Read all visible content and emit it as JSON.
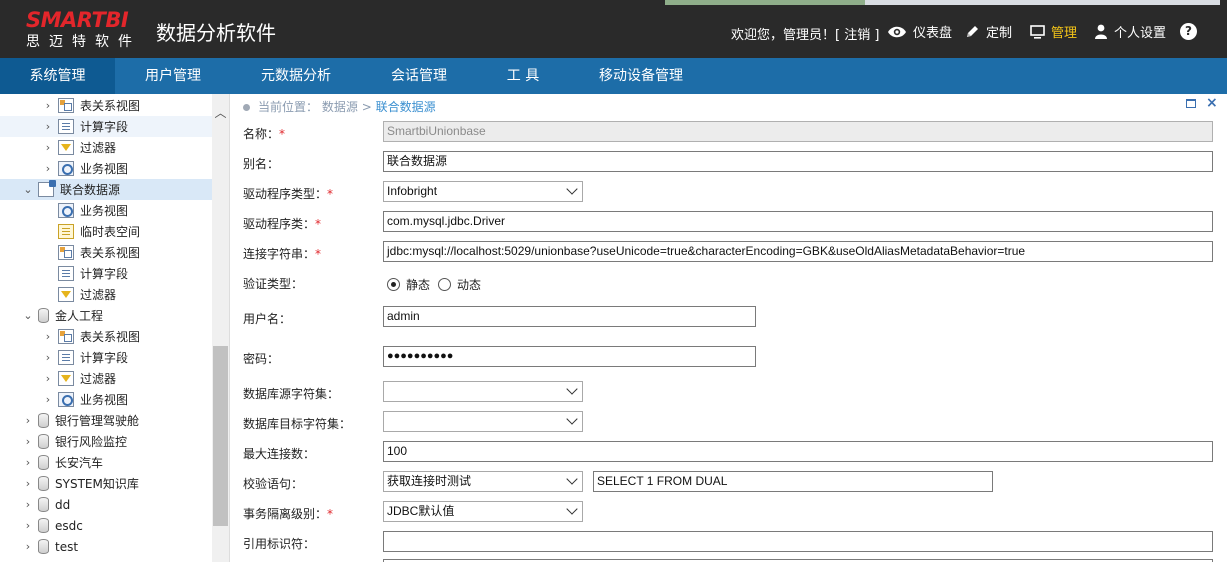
{
  "header": {
    "logo_top": "SMARTBI",
    "logo_bottom": "思迈特软件",
    "app_title": "数据分析软件",
    "welcome": "欢迎您，管理员！[ 注销 ]",
    "nav": [
      {
        "label": "仪表盘",
        "icon": "eye-icon"
      },
      {
        "label": "定制",
        "icon": "pencil-icon"
      },
      {
        "label": "管理",
        "icon": "monitor-icon",
        "active": true
      },
      {
        "label": "个人设置",
        "icon": "user-icon"
      }
    ],
    "help": "?",
    "accent_color": "#f5c518",
    "header_bg": "#2a2a2a"
  },
  "menubar": {
    "items": [
      "系统管理",
      "用户管理",
      "元数据分析",
      "会话管理",
      "工 具",
      "移动设备管理"
    ],
    "active_index": 0,
    "bg_color": "#1d6da8"
  },
  "tree": [
    {
      "label": "表关系视图",
      "icon": "table-relation-icon",
      "expander": "collapsed"
    },
    {
      "label": "计算字段",
      "icon": "calc-field-icon",
      "expander": "collapsed"
    },
    {
      "label": "过滤器",
      "icon": "filter-icon",
      "expander": "collapsed"
    },
    {
      "label": "业务视图",
      "icon": "business-view-icon",
      "expander": "collapsed"
    },
    {
      "label": "联合数据源",
      "icon": "union-datasource-icon",
      "expander": "expanded",
      "selected": true
    },
    {
      "label": "业务视图",
      "icon": "business-view-icon",
      "expander": "none"
    },
    {
      "label": "临时表空间",
      "icon": "temp-table-icon",
      "expander": "none"
    },
    {
      "label": "表关系视图",
      "icon": "table-relation-icon",
      "expander": "none"
    },
    {
      "label": "计算字段",
      "icon": "calc-field-icon",
      "expander": "none"
    },
    {
      "label": "过滤器",
      "icon": "filter-icon",
      "expander": "none"
    },
    {
      "label": "金人工程",
      "icon": "database-icon",
      "expander": "expanded"
    },
    {
      "label": "表关系视图",
      "icon": "table-relation-icon",
      "expander": "collapsed"
    },
    {
      "label": "计算字段",
      "icon": "calc-field-icon",
      "expander": "collapsed"
    },
    {
      "label": "过滤器",
      "icon": "filter-icon",
      "expander": "collapsed"
    },
    {
      "label": "业务视图",
      "icon": "business-view-icon",
      "expander": "collapsed"
    },
    {
      "label": "银行管理驾驶舱",
      "icon": "database-icon",
      "expander": "collapsed"
    },
    {
      "label": "银行风险监控",
      "icon": "database-icon",
      "expander": "collapsed"
    },
    {
      "label": "长安汽车",
      "icon": "database-icon",
      "expander": "collapsed"
    },
    {
      "label": "SYSTEM知识库",
      "icon": "database-icon",
      "expander": "collapsed"
    },
    {
      "label": "dd",
      "icon": "database-icon",
      "expander": "collapsed"
    },
    {
      "label": "esdc",
      "icon": "database-icon",
      "expander": "collapsed"
    },
    {
      "label": "test",
      "icon": "database-icon",
      "expander": "collapsed"
    }
  ],
  "breadcrumb": {
    "prefix": "当前位置：",
    "parent": "数据源",
    "sep": ">",
    "current": "联合数据源"
  },
  "form": {
    "name_label": "名称：",
    "name_value": "SmartbiUnionbase",
    "alias_label": "别名：",
    "alias_value": "联合数据源",
    "driver_type_label": "驱动程序类型：",
    "driver_type_value": "Infobright",
    "driver_class_label": "驱动程序类：",
    "driver_class_value": "com.mysql.jdbc.Driver",
    "conn_label": "连接字符串：",
    "conn_value": "jdbc:mysql://localhost:5029/unionbase?useUnicode=true&characterEncoding=GBK&useOldAliasMetadataBehavior=true",
    "auth_label": "验证类型：",
    "auth_static": "静态",
    "auth_dynamic": "动态",
    "auth_selected": "静态",
    "user_label": "用户名：",
    "user_value": "admin",
    "pwd_label": "密码：",
    "pwd_value": "●●●●●●●●●●",
    "src_charset_label": "数据库源字符集：",
    "src_charset_value": "",
    "dst_charset_label": "数据库目标字符集：",
    "dst_charset_value": "",
    "maxconn_label": "最大连接数：",
    "maxconn_value": "100",
    "validate_label": "校验语句：",
    "validate_mode_value": "获取连接时测试",
    "validate_sql_value": "SELECT 1 FROM DUAL",
    "isolation_label": "事务隔离级别：",
    "isolation_value": "JDBC默认值",
    "quote_label": "引用标识符：",
    "quote_value": "",
    "required_mark": "*"
  }
}
